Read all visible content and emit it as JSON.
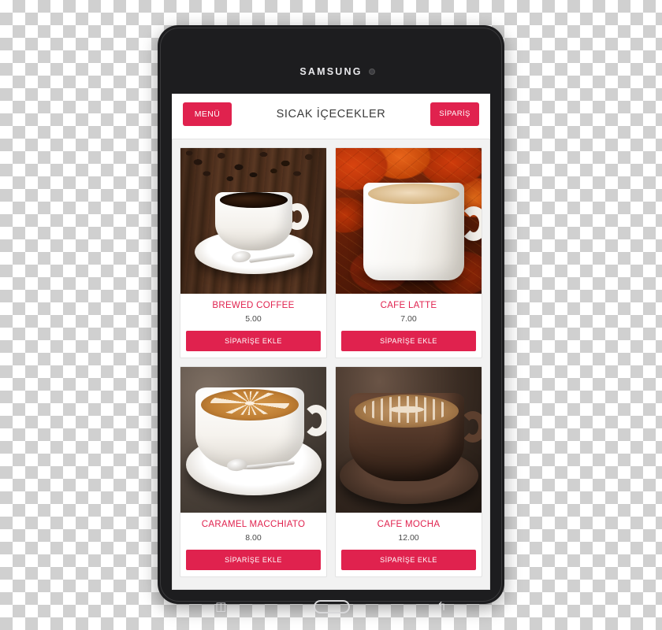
{
  "device": {
    "brand": "SAMSUNG",
    "camera_icon": "front-camera-dot"
  },
  "app": {
    "header": {
      "menu_label": "MENÜ",
      "title": "SICAK İÇECEKLER",
      "order_label": "SİPARİŞ"
    },
    "products": [
      {
        "name": "BREWED COFFEE",
        "price": "5.00",
        "button": "SİPARİŞE EKLE",
        "image": "black-coffee-white-cup-on-wood"
      },
      {
        "name": "CAFE LATTE",
        "price": "7.00",
        "button": "SİPARİŞE EKLE",
        "image": "latte-mug-autumn-leaves"
      },
      {
        "name": "CARAMEL MACCHIATO",
        "price": "8.00",
        "button": "SİPARİŞE EKLE",
        "image": "latte-art-star-white-cup"
      },
      {
        "name": "CAFE MOCHA",
        "price": "12.00",
        "button": "SİPARİŞE EKLE",
        "image": "mocha-dark-cup-latte-art"
      }
    ]
  },
  "navbar": {
    "recents_icon": "recents-icon",
    "home_icon": "home-pill-icon",
    "back_icon": "↰"
  },
  "colors": {
    "accent": "#e0224e",
    "title_text": "#3b3b3b",
    "screen_bg": "#f2f2f2",
    "device_body": "#1d1d1f"
  }
}
